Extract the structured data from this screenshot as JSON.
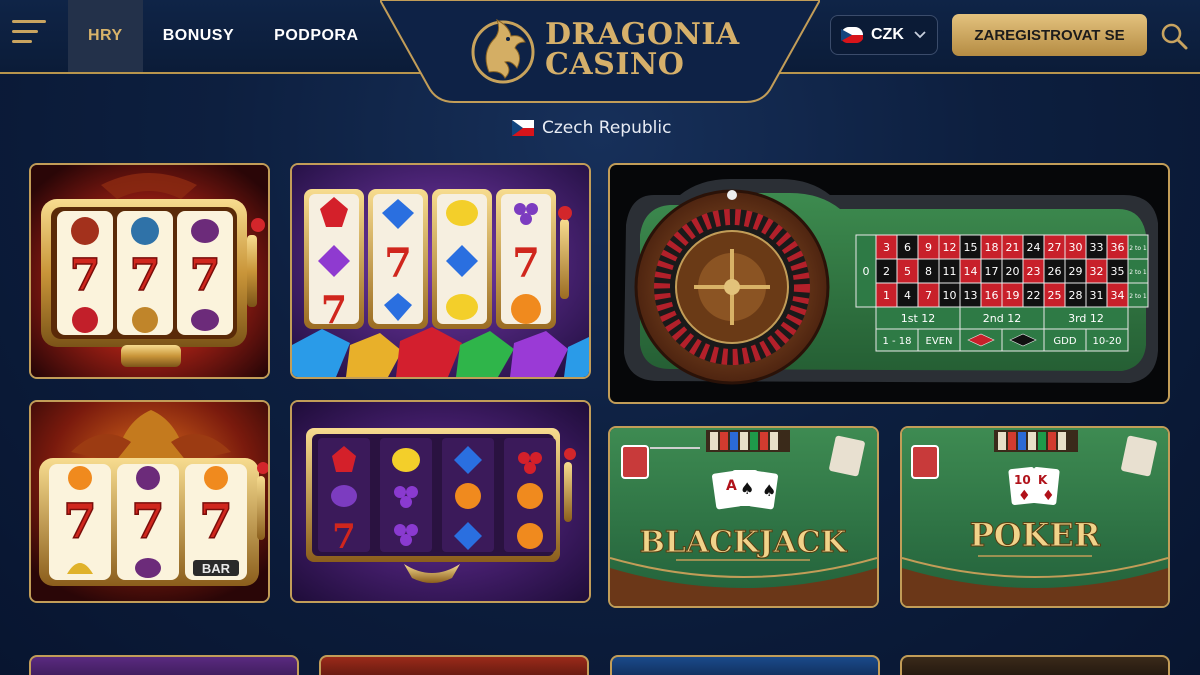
{
  "header": {
    "nav": [
      {
        "label": "HRY",
        "active": true
      },
      {
        "label": "BONUSY",
        "active": false
      },
      {
        "label": "PODPORA",
        "active": false
      }
    ],
    "logo": {
      "line1": "DRAGONIA",
      "line2": "CASINO"
    },
    "currency": {
      "code": "CZK"
    },
    "register_label": "ZAREGISTROVAT SE"
  },
  "country": {
    "name": "Czech Republic"
  },
  "games": {
    "roulette": {
      "zero": "0",
      "rows": [
        [
          "3",
          "6",
          "9",
          "12",
          "15",
          "18",
          "21",
          "24",
          "27",
          "30",
          "33",
          "36"
        ],
        [
          "2",
          "5",
          "8",
          "11",
          "14",
          "17",
          "20",
          "23",
          "26",
          "29",
          "32",
          "35"
        ],
        [
          "1",
          "4",
          "7",
          "10",
          "13",
          "16",
          "19",
          "22",
          "25",
          "28",
          "31",
          "34"
        ]
      ],
      "columns": [
        "2 to 1",
        "2 to 1",
        "2 to 1"
      ],
      "dozens": [
        "1st 12",
        "2nd 12",
        "3rd 12"
      ],
      "outside": [
        "1 - 18",
        "EVEN",
        "GDD",
        "10-20"
      ]
    },
    "blackjack_label": "BLACKJACK",
    "poker_label": "POKER",
    "slot_bar_label": "BAR"
  },
  "colors": {
    "gold": "#c29d58",
    "navy": "#0d1f3f",
    "felt": "#2f7a46",
    "red": "#c8202a"
  }
}
